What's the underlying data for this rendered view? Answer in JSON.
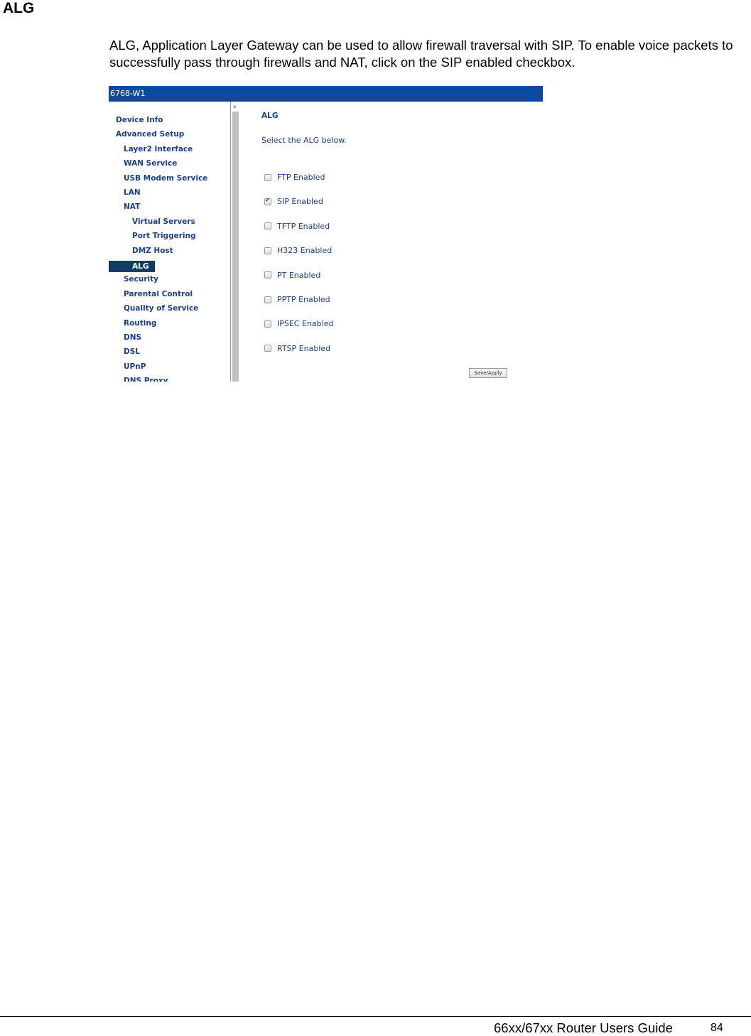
{
  "document": {
    "title": "ALG",
    "intro": "ALG, Application Layer Gateway can be used to allow firewall traversal with SIP.  To enable voice packets to successfully pass through firewalls and NAT, click on the SIP enabled checkbox."
  },
  "screenshot": {
    "header_title": "6768-W1",
    "nav": [
      {
        "label": "Device Info",
        "level": 0
      },
      {
        "label": "Advanced Setup",
        "level": 0
      },
      {
        "label": "Layer2 Interface",
        "level": 1
      },
      {
        "label": "WAN Service",
        "level": 1
      },
      {
        "label": "USB Modem Service",
        "level": 1
      },
      {
        "label": "LAN",
        "level": 1
      },
      {
        "label": "NAT",
        "level": 1
      },
      {
        "label": "Virtual Servers",
        "level": 2
      },
      {
        "label": "Port Triggering",
        "level": 2
      },
      {
        "label": "DMZ Host",
        "level": 2
      },
      {
        "label": "ALG",
        "level": 2,
        "active": true
      },
      {
        "label": "Security",
        "level": 1
      },
      {
        "label": "Parental Control",
        "level": 1
      },
      {
        "label": "Quality of Service",
        "level": 1
      },
      {
        "label": "Routing",
        "level": 1
      },
      {
        "label": "DNS",
        "level": 1
      },
      {
        "label": "DSL",
        "level": 1
      },
      {
        "label": "UPnP",
        "level": 1
      },
      {
        "label": "DNS Proxy",
        "level": 1
      }
    ],
    "content": {
      "title": "ALG",
      "subtitle": "Select the ALG below.",
      "options": [
        {
          "label": "FTP Enabled",
          "checked": false
        },
        {
          "label": "SIP Enabled",
          "checked": true
        },
        {
          "label": "TFTP Enabled",
          "checked": false
        },
        {
          "label": "H323 Enabled",
          "checked": false
        },
        {
          "label": "PT Enabled",
          "checked": false
        },
        {
          "label": "PPTP Enabled",
          "checked": false
        },
        {
          "label": "IPSEC Enabled",
          "checked": false
        },
        {
          "label": "RTSP Enabled",
          "checked": false
        }
      ],
      "save_label": "Save/Apply"
    }
  },
  "footer": {
    "guide_title": "66xx/67xx Router Users Guide",
    "page_number": "84"
  }
}
